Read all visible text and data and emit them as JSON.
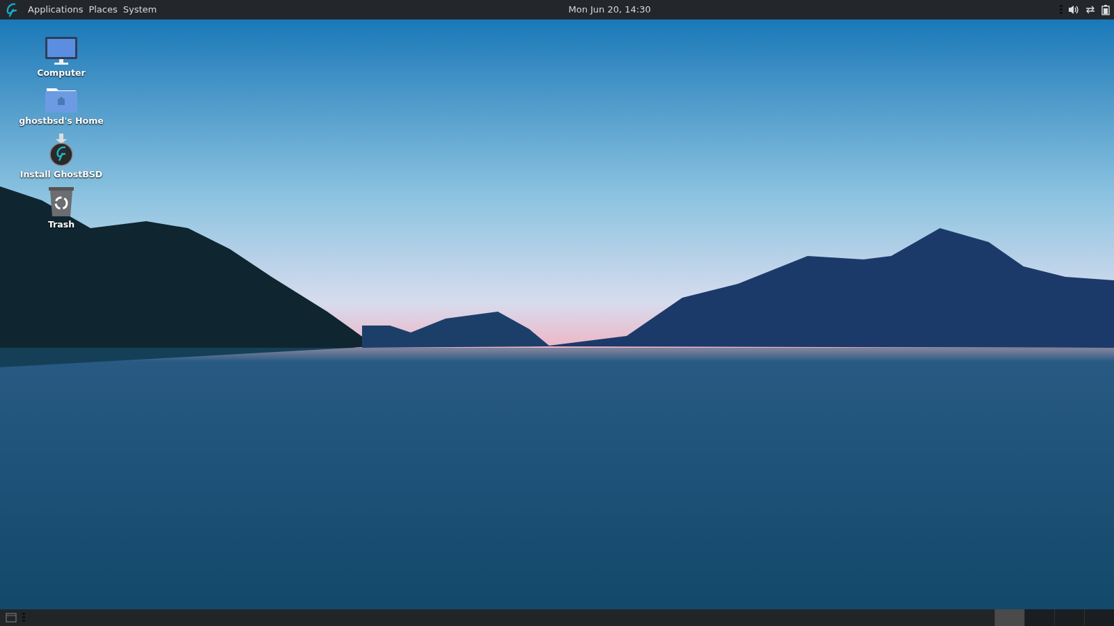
{
  "top_panel": {
    "menus": [
      "Applications",
      "Places",
      "System"
    ],
    "clock": "Mon Jun 20, 14:30"
  },
  "desktop_icons": [
    {
      "label": "Computer",
      "kind": "computer"
    },
    {
      "label": "ghostbsd's Home",
      "kind": "home"
    },
    {
      "label": "Install GhostBSD",
      "kind": "installer"
    },
    {
      "label": "Trash",
      "kind": "trash"
    }
  ],
  "bottom_panel": {
    "workspaces": [
      {
        "selected": true
      },
      {
        "selected": false
      },
      {
        "selected": false
      },
      {
        "selected": false
      }
    ]
  }
}
